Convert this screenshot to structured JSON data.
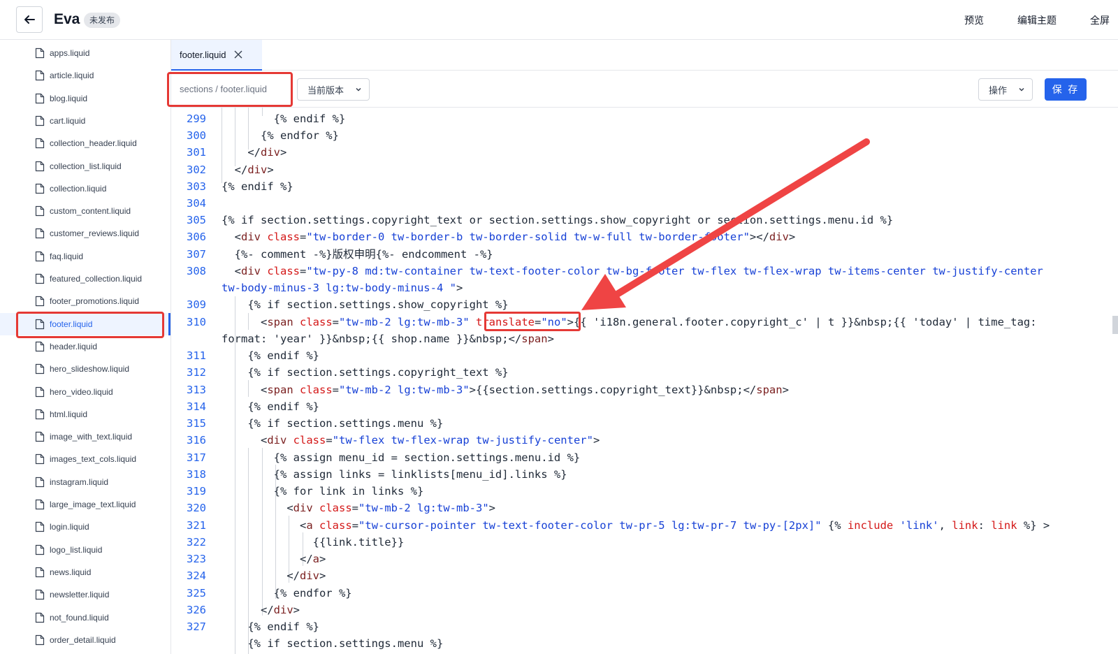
{
  "header": {
    "title": "Eva",
    "status_badge": "未发布",
    "actions": [
      "预览",
      "编辑主题",
      "全屏"
    ]
  },
  "sidebar": {
    "items": [
      "apps.liquid",
      "article.liquid",
      "blog.liquid",
      "cart.liquid",
      "collection_header.liquid",
      "collection_list.liquid",
      "collection.liquid",
      "custom_content.liquid",
      "customer_reviews.liquid",
      "faq.liquid",
      "featured_collection.liquid",
      "footer_promotions.liquid",
      "footer.liquid",
      "header.liquid",
      "hero_slideshow.liquid",
      "hero_video.liquid",
      "html.liquid",
      "image_with_text.liquid",
      "images_text_cols.liquid",
      "instagram.liquid",
      "large_image_text.liquid",
      "login.liquid",
      "logo_list.liquid",
      "news.liquid",
      "newsletter.liquid",
      "not_found.liquid",
      "order_detail.liquid"
    ],
    "active_index": 12
  },
  "tabs": [
    {
      "label": "footer.liquid"
    }
  ],
  "toolbar": {
    "path": "sections / footer.liquid",
    "version_label": "当前版本",
    "action_label": "操作",
    "save_label": "保 存"
  },
  "editor": {
    "line_numbers": [
      "299",
      "300",
      "301",
      "302",
      "303",
      "304",
      "305",
      "306",
      "307",
      "308",
      "309",
      "310",
      "311",
      "312",
      "313",
      "314",
      "315",
      "316",
      "317",
      "318",
      "319",
      "320",
      "321",
      "322",
      "323",
      "324",
      "325",
      "326",
      "327"
    ]
  },
  "colors": {
    "accent": "#2563eb",
    "highlight": "#e53935"
  }
}
